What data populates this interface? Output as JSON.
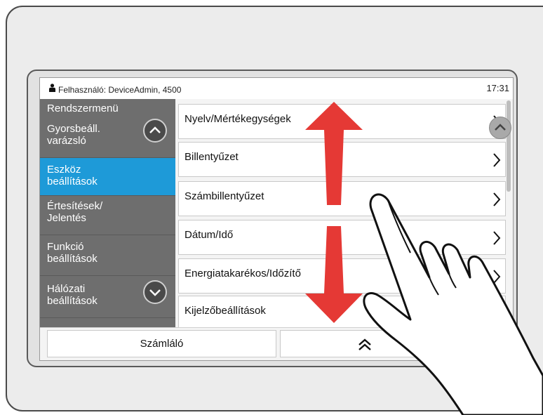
{
  "status": {
    "user_text": "Felhasználó: DeviceAdmin, 4500",
    "time": "17:31"
  },
  "sidebar": {
    "header": "Rendszermenü",
    "items": [
      {
        "label": "Gyorsbeáll. varázsló",
        "active": false
      },
      {
        "label": "Eszköz beállítások",
        "active": true
      },
      {
        "label": "Értesítések/ Jelentés",
        "active": false
      },
      {
        "label": "Funkció beállítások",
        "active": false
      },
      {
        "label": "Hálózati beállítások",
        "active": false
      }
    ],
    "scroll_up_icon": "chevron-up-icon",
    "scroll_down_icon": "chevron-down-icon"
  },
  "menu": {
    "items": [
      {
        "label": "Nyelv/Mértékegységek"
      },
      {
        "label": "Billentyűzet"
      },
      {
        "label": "Számbillentyűzet"
      },
      {
        "label": "Dátum/Idő"
      },
      {
        "label": "Energiatakarékos/Időzítő"
      },
      {
        "label": "Kijelzőbeállítások"
      }
    ]
  },
  "bottom": {
    "counter_label": "Számláló",
    "home_icon": "double-chevron-up-icon"
  },
  "overlay": {
    "arrow_color": "#e53935",
    "gesture": "vertical-swipe",
    "hand_icon": "pointing-hand-icon"
  }
}
